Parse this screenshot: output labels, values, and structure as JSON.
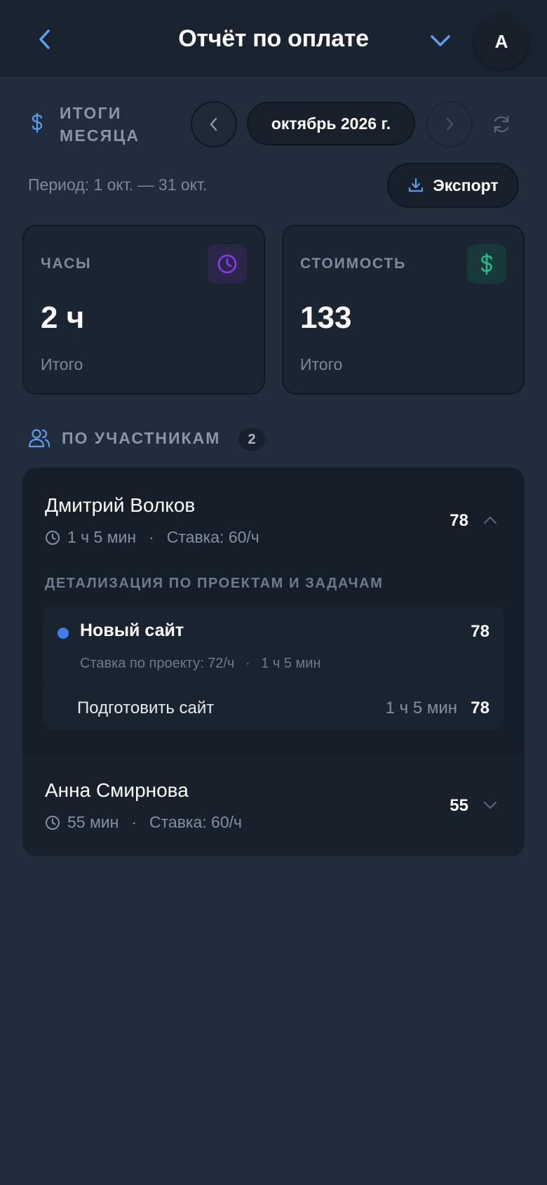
{
  "header": {
    "title": "Отчёт по оплате",
    "avatar_letter": "А",
    "icons": {
      "back": "chevron-left-icon",
      "menu": "chevron-down-icon"
    }
  },
  "summary": {
    "title": "ИТОГИ МЕСЯЦА",
    "month": "октябрь 2026 г.",
    "period": "Период: 1 окт. — 31 окт.",
    "export_label": "Экспорт"
  },
  "stats": [
    {
      "label": "ЧАСЫ",
      "value": "2 ч",
      "sub": "Итого",
      "icon": "clock-icon",
      "color": "#8b3cf7"
    },
    {
      "label": "СТОИМОСТЬ",
      "value": "133",
      "sub": "Итого",
      "icon": "dollar-icon",
      "color": "#1fbf8f"
    }
  ],
  "members_section": {
    "title": "ПО УЧАСТНИКАМ",
    "count": "2"
  },
  "members": [
    {
      "name": "Дмитрий Волков",
      "time": "1 ч 5 мин",
      "rate": "Ставка: 60/ч",
      "amount": "78",
      "expanded": true,
      "detail_title": "ДЕТАЛИЗАЦИЯ ПО ПРОЕКТАМ И ЗАДАЧАМ",
      "projects": [
        {
          "name": "Новый сайт",
          "amount": "78",
          "rate": "Ставка по проекту: 72/ч",
          "time": "1 ч 5 мин",
          "color": "#3c7ef0",
          "tasks": [
            {
              "name": "Подготовить сайт",
              "time": "1 ч 5 мин",
              "amount": "78"
            }
          ]
        }
      ]
    },
    {
      "name": "Анна Смирнова",
      "time": "55 мин",
      "rate": "Ставка: 60/ч",
      "amount": "55",
      "expanded": false
    }
  ],
  "colors": {
    "accent": "#5aa0f0",
    "background": "#212c3c"
  }
}
